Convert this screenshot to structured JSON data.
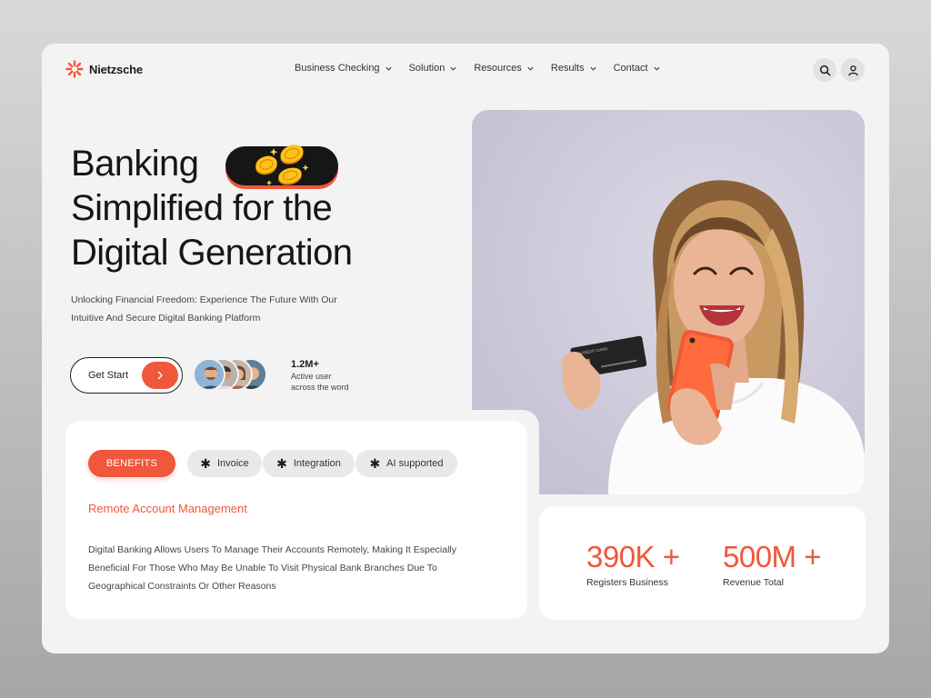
{
  "brand": {
    "name": "Nietzsche",
    "accent": "#f0573b"
  },
  "nav": {
    "items": [
      {
        "label": "Business Checking"
      },
      {
        "label": "Solution"
      },
      {
        "label": "Resources"
      },
      {
        "label": "Results"
      },
      {
        "label": "Contact"
      }
    ],
    "search_icon": "search-icon",
    "user_icon": "user-icon"
  },
  "hero": {
    "title_line1": "Banking",
    "title_line2": "Simplified for the",
    "title_line3": "Digital Generation",
    "subtitle_line1": "Unlocking Financial Freedom: Experience The Future With Our",
    "subtitle_line2": "Intuitive And Secure Digital Banking Platform",
    "cta_label": "Get Start",
    "users_count": "1.2M+",
    "users_label_line1": "Active user",
    "users_label_line2": "across the word"
  },
  "benefits": {
    "tabs": [
      {
        "label": "BENEFITS",
        "active": true
      },
      {
        "label": "Invoice",
        "active": false
      },
      {
        "label": "Integration",
        "active": false
      },
      {
        "label": "AI supported",
        "active": false
      }
    ],
    "heading": "Remote Account Management",
    "body_line1": "Digital Banking Allows Users To Manage Their Accounts Remotely, Making It Especially",
    "body_line2": "Beneficial For Those Who May Be Unable To Visit Physical Bank Branches Due To",
    "body_line3": "Geographical Constraints Or Other Reasons"
  },
  "stats": [
    {
      "value": "390K +",
      "label": "Registers Business"
    },
    {
      "value": "500M +",
      "label": "Revenue Total"
    }
  ],
  "photo": {
    "card_label": "CREDIT CARD"
  }
}
